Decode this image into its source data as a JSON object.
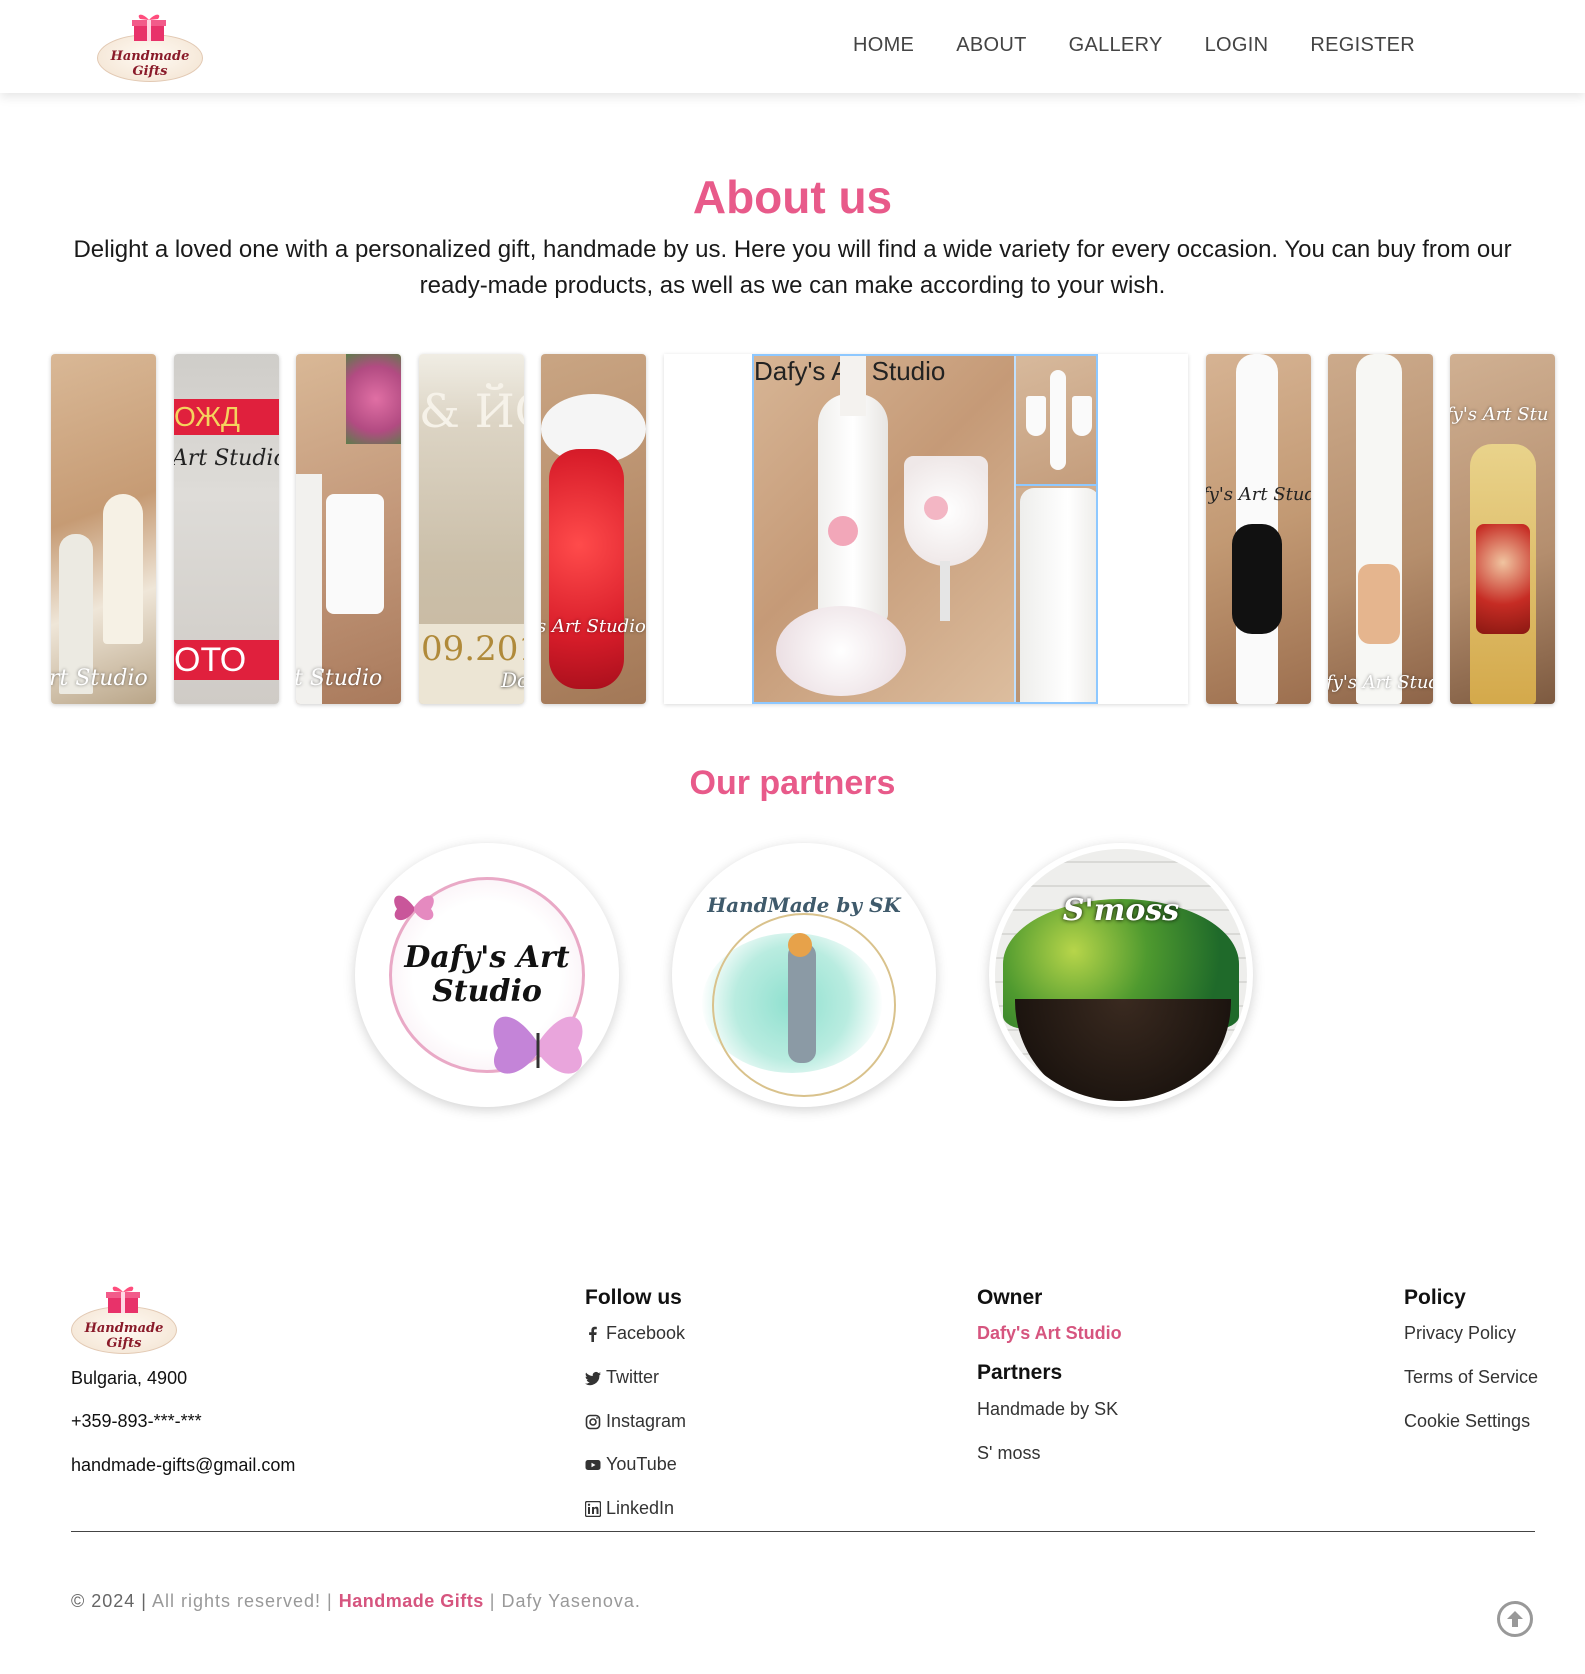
{
  "header": {
    "logo": {
      "line1": "Handmade",
      "line2": "Gifts"
    },
    "nav": [
      "HOME",
      "ABOUT",
      "GALLERY",
      "LOGIN",
      "REGISTER"
    ]
  },
  "about": {
    "title": "About us",
    "text": "Delight a loved one with a personalized gift, handmade by us. Here you will find a wide variety for every occasion. You can buy from our ready-made products, as well as we can make according to your wish."
  },
  "gallery": {
    "watermarks": [
      "rt Studio",
      "Art Studio",
      "t Studio",
      "09.201",
      "s Art Studio",
      "Dafy's Art Studio",
      "fy's Art Stud",
      "fy's Art Stud",
      "fy's Art Stu"
    ],
    "tiny_labels": [
      "ОЖД",
      "ОТО",
      "& ЙС",
      "Dc"
    ]
  },
  "partners": {
    "title": "Our partners",
    "logos": [
      "Dafy's Art Studio",
      "HandMade by SK",
      "S'moss"
    ]
  },
  "footer": {
    "logo": {
      "line1": "Handmade",
      "line2": "Gifts"
    },
    "address": "Bulgaria, 4900",
    "phone": "+359-893-***-***",
    "email": "handmade-gifts@gmail.com",
    "follow": {
      "title": "Follow us",
      "links": [
        "Facebook",
        "Twitter",
        "Instagram",
        "YouTube",
        "LinkedIn"
      ]
    },
    "owner": {
      "title": "Owner",
      "name": "Dafy's Art Studio"
    },
    "partners": {
      "title": "Partners",
      "links": [
        "Handmade by SK",
        "S' moss"
      ]
    },
    "policy": {
      "title": "Policy",
      "links": [
        "Privacy Policy",
        "Terms of Service",
        "Cookie Settings"
      ]
    },
    "copyright": {
      "year": "© 2024 |",
      "rights": "All rights reserved! |",
      "brand": "Handmade Gifts",
      "author": "| Dafy Yasenova."
    }
  },
  "colors": {
    "accent": "#e85a8a",
    "link_pink": "#d6557f"
  }
}
